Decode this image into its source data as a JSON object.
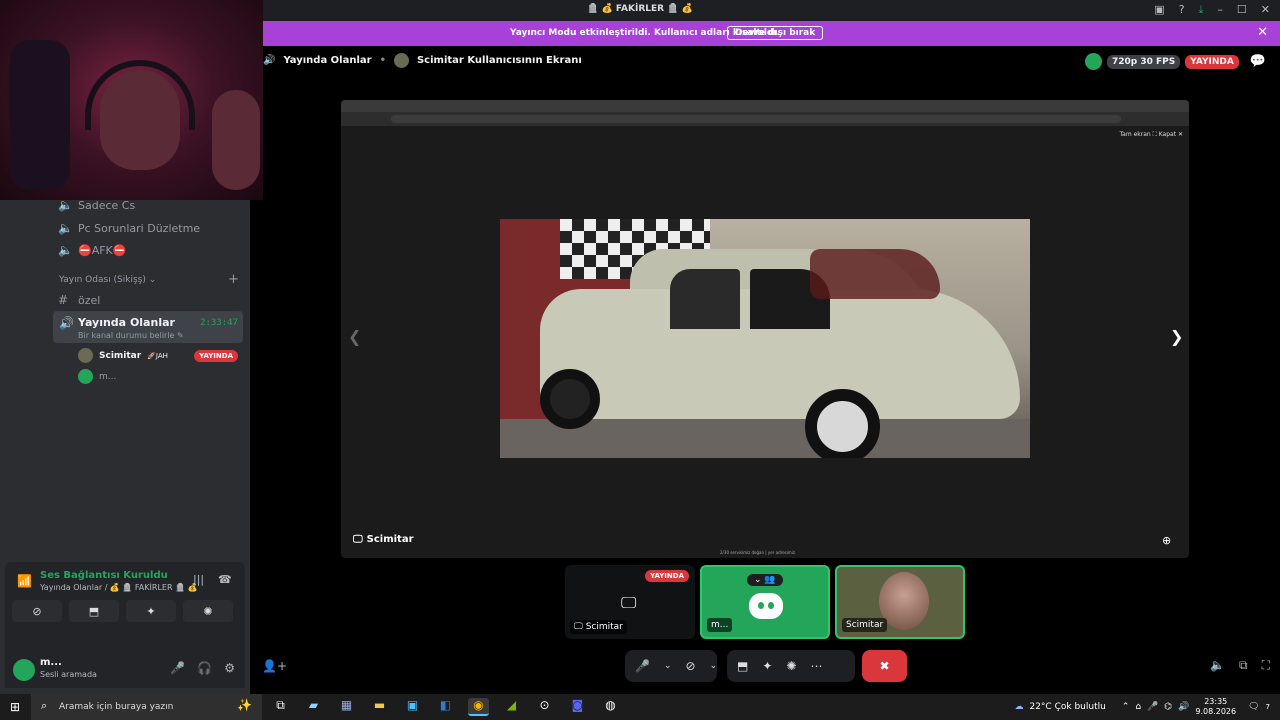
{
  "titlebar": {
    "title": "🪦 💰 FAKİRLER 🪦 💰"
  },
  "banner": {
    "text": "Yayıncı Modu etkinleştirildi. Kullanıcı adları kısaltıldı.",
    "button": "Devre dışı bırak"
  },
  "sidebar": {
    "channels": [
      {
        "label": "Sadece Cs"
      },
      {
        "label": "Pc Sorunlari Düzletme"
      },
      {
        "label": "⛔AFK⛔"
      }
    ],
    "category": "Yayın Odası (Sikişş) ⌄",
    "text_channel": "özel",
    "active": {
      "name": "Yayında Olanlar",
      "sub": "Bir kanal durumu belirle ✎",
      "time": "2:33:47"
    },
    "members": [
      {
        "name": "Scimitar",
        "tag": "🚀JAH",
        "badge": "YAYINDA"
      },
      {
        "name": "m..."
      }
    ]
  },
  "voice": {
    "status": "Ses Bağlantısı Kuruldu",
    "sub": "Yayında Olanlar / 💰 🪦 FAKİRLER 🪦 💰"
  },
  "user": {
    "name": "m...",
    "status": "Sesli aramada"
  },
  "stage": {
    "channel": "Yayında Olanlar",
    "screen_title": "Scimitar Kullanıcısının Ekranı",
    "quality": "720p 30 FPS",
    "live_badge": "YAYINDA",
    "screen_label": "Scimitar",
    "viewer_top": "Tam ekran ⛶   Kapat ✕",
    "caption": "2/30     servisimiz doğan | yer adresimiz"
  },
  "tiles": [
    {
      "label": "Scimitar",
      "badge": "YAYINDA"
    },
    {
      "label": "m..."
    },
    {
      "label": "Scimitar"
    }
  ],
  "taskbar": {
    "search_placeholder": "Aramak için buraya yazın",
    "weather": "22°C  Çok bulutlu",
    "time": "23:35",
    "date": "9.08.2026",
    "notifications": "7"
  }
}
